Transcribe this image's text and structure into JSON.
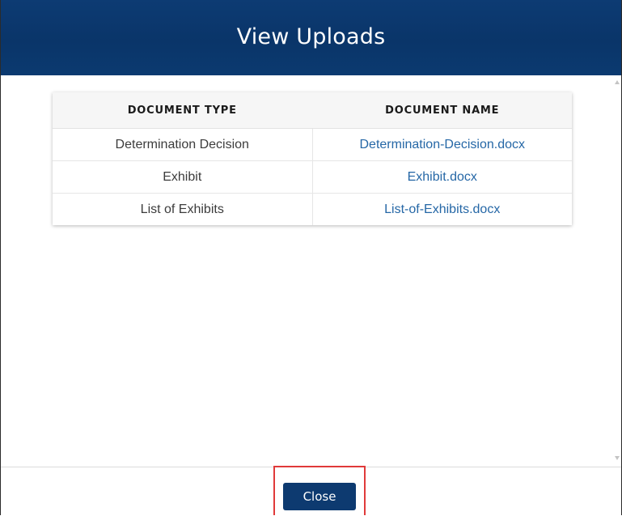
{
  "modal": {
    "title": "View Uploads",
    "table": {
      "headers": [
        "DOCUMENT TYPE",
        "DOCUMENT NAME"
      ],
      "rows": [
        {
          "type": "Determination Decision",
          "name": "Determination-Decision.docx"
        },
        {
          "type": "Exhibit",
          "name": "Exhibit.docx"
        },
        {
          "type": "List of Exhibits",
          "name": "List-of-Exhibits.docx"
        }
      ]
    },
    "footer": {
      "close_label": "Close"
    }
  },
  "colors": {
    "header_bg": "#0a3569",
    "link": "#2567a6",
    "button_bg": "#0d3a70",
    "highlight": "#e03a3a"
  }
}
